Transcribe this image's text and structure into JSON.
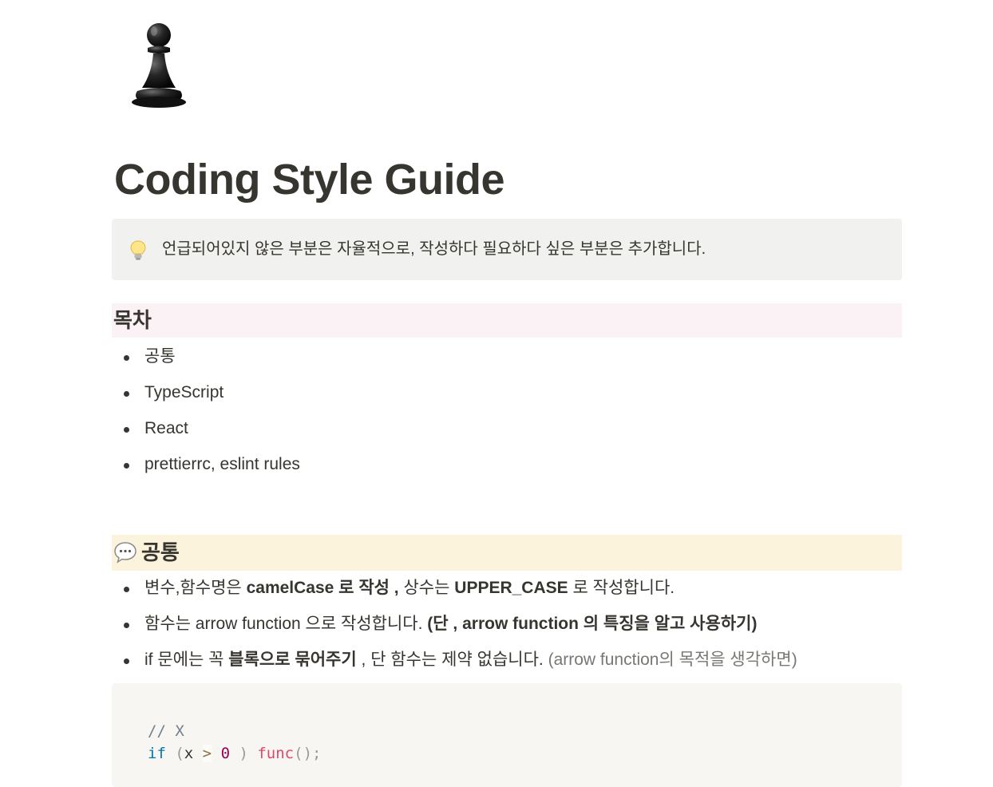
{
  "page": {
    "icon": "chess-pawn-icon",
    "title": "Coding Style Guide"
  },
  "callout": {
    "icon": "light-bulb-icon",
    "text": "언급되어있지 않은 부분은 자율적으로, 작성하다 필요하다 싶은 부분은 추가합니다."
  },
  "toc": {
    "heading": "목차",
    "items": [
      "공통",
      "TypeScript",
      "React",
      "prettierrc, eslint rules"
    ]
  },
  "common": {
    "icon": "speech-balloon-icon",
    "heading": "공통",
    "rules": [
      {
        "t1": "변수,함수명은 ",
        "b1": "camelCase 로 작성 ,",
        "t2": " 상수는 ",
        "b2": "UPPER_CASE",
        "t3": " 로 작성합니다."
      },
      {
        "t1": "함수는 arrow function 으로 작성합니다. ",
        "b1": "(단 , arrow function 의 특징을 알고 사용하기)"
      },
      {
        "t1": "if 문에는 꼭 ",
        "b1": "블록으로 묶어주기",
        "t2": " , 단 함수는 제약 없습니다. ",
        "muted": "(arrow function의 목적을 생각하면)"
      }
    ]
  },
  "code_block": {
    "line1": "// X",
    "line2": {
      "kw": "if",
      "p1": " (",
      "v": "x ",
      "op": ">",
      "sp": " ",
      "num": "0",
      "p2": " ) ",
      "fn": "func",
      "p3": "();"
    }
  },
  "colors": {
    "text": "#37352f",
    "callout_bg": "#f1f1ef",
    "toc_heading_bg": "#fbf2f5",
    "common_heading_bg": "#fbf3db",
    "code_bg": "#f7f6f3",
    "muted": "#787774"
  }
}
